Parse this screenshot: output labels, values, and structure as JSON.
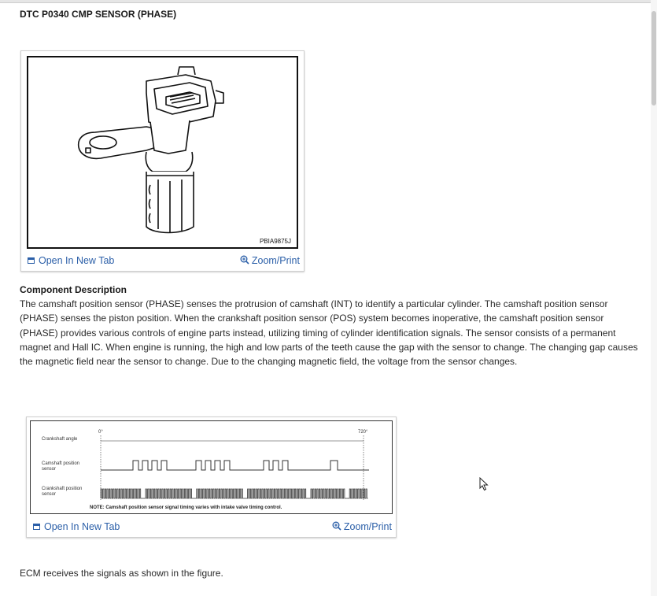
{
  "document": {
    "title": "DTC P0340 CMP SENSOR (PHASE)"
  },
  "figure1": {
    "code": "PBIA9875J",
    "open_label": "Open In New Tab",
    "zoom_label": "Zoom/Print"
  },
  "component": {
    "heading": "Component Description",
    "body": "The camshaft position sensor (PHASE) senses the protrusion of camshaft (INT) to identify a particular cylinder. The camshaft position sensor (PHASE) senses the piston position. When the crankshaft position sensor (POS) system becomes inoperative, the camshaft position sensor (PHASE) provides various controls of engine parts instead, utilizing timing of cylinder identification signals. The sensor consists of a permanent magnet and Hall IC. When engine is running, the high and low parts of the teeth cause the gap with the sensor to change. The changing gap causes the magnetic field near the sensor to change. Due to the changing magnetic field, the voltage from the sensor changes."
  },
  "figure2": {
    "crank_angle_label": "Crankshaft angle",
    "cam_sensor_label_line1": "Camshaft position",
    "cam_sensor_label_line2": "sensor",
    "crank_sensor_label_line1": "Crankshaft position",
    "crank_sensor_label_line2": "sensor",
    "angle_start": "0°",
    "angle_end": "720°",
    "note": "NOTE: Camshaft position sensor signal timing varies with intake valve timing control.",
    "open_label": "Open In New Tab",
    "zoom_label": "Zoom/Print"
  },
  "footer_text": "ECM receives the signals as shown in the figure.",
  "colors": {
    "link": "#2b5fa8",
    "text": "#2a2a2a"
  }
}
